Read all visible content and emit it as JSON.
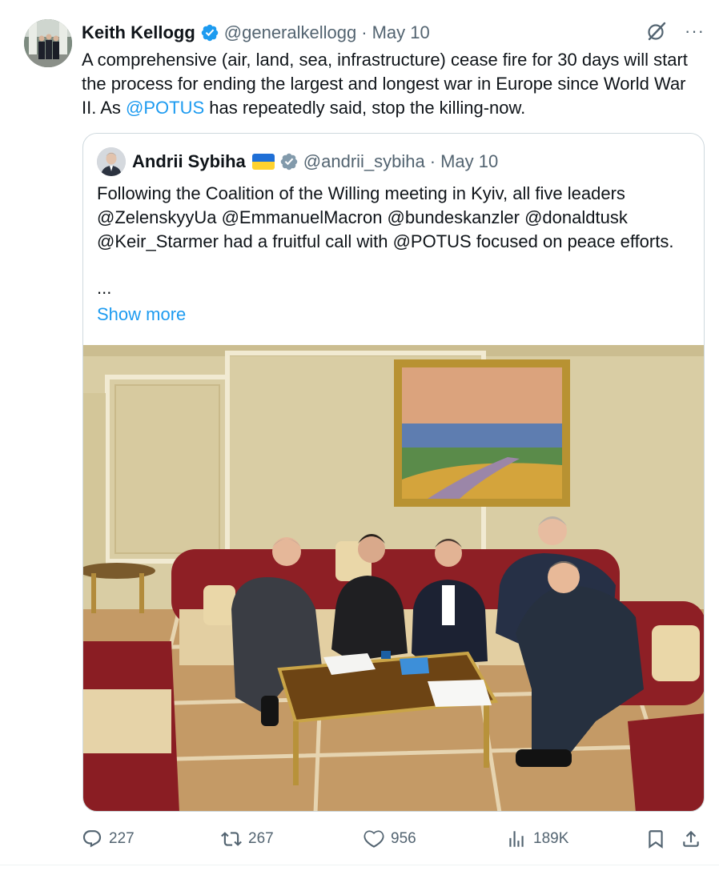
{
  "tweet": {
    "author_name": "Keith Kellogg",
    "handle": "@generalkellogg",
    "separator": "·",
    "date": "May 10",
    "text_part1": "A comprehensive (air, land, sea, infrastructure) cease fire for 30 days will start the process for ending the largest and longest war in Europe since World War II.  As ",
    "text_mention": "@POTUS",
    "text_part2": " has repeatedly said, stop the killing-now.",
    "more_label": "···",
    "icons": {
      "verified": "verified-badge-icon",
      "grok": "grok-icon",
      "more": "more-icon"
    }
  },
  "quote": {
    "author_name": "Andrii Sybiha",
    "flag": "ukraine-flag",
    "handle": "@andrii_sybiha",
    "separator": "·",
    "date": "May 10",
    "text": "Following the Coalition of the Willing meeting in Kyiv, all five leaders @ZelenskyyUa @EmmanuelMacron @bundeskanzler @donaldtusk @Keir_Starmer had a fruitful call with @POTUS focused on peace efforts.",
    "ellipsis": "...",
    "show_more": "Show more"
  },
  "actions": {
    "replies": "227",
    "reposts": "267",
    "likes": "956",
    "views": "189K"
  },
  "colors": {
    "link": "#1d9bf0",
    "muted": "#536471",
    "text": "#0f1419",
    "border": "#cfd9de"
  }
}
